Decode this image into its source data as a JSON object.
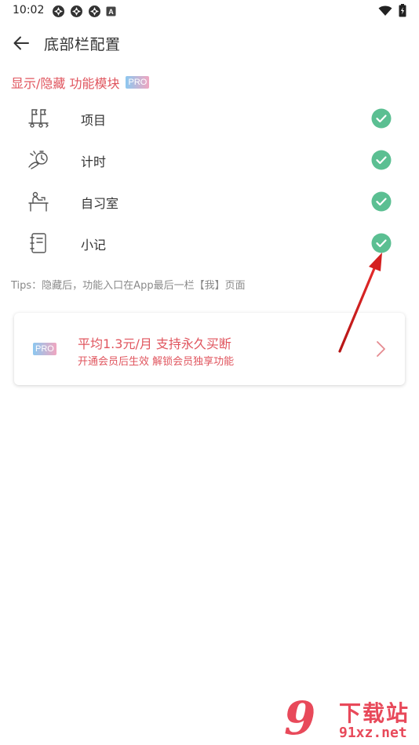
{
  "status_bar": {
    "time": "10:02",
    "left_icons": [
      "notification-icon",
      "notification-icon",
      "notification-icon",
      "keyboard-icon"
    ],
    "right_icons": [
      "wifi-icon",
      "battery-icon"
    ]
  },
  "app_bar": {
    "back_icon": "arrow-left-icon",
    "title": "底部栏配置"
  },
  "section": {
    "title": "显示/隐藏 功能模块",
    "badge": "PRO"
  },
  "modules": [
    {
      "label": "项目",
      "icon": "project-flag-icon",
      "checked": true
    },
    {
      "label": "计时",
      "icon": "timer-hand-icon",
      "checked": true
    },
    {
      "label": "自习室",
      "icon": "study-room-desk-icon",
      "checked": true
    },
    {
      "label": "小记",
      "icon": "notebook-icon",
      "checked": true
    }
  ],
  "tips": "Tips：隐藏后，功能入口在App最后一栏【我】页面",
  "pro_card": {
    "badge": "PRO",
    "title": "平均1.3元/月 支持永久买断",
    "subtitle": "开通会员后生效 解锁会员独享功能",
    "chevron_icon": "chevron-right-icon"
  },
  "colors": {
    "accent": "#e0555e",
    "check_green": "#5bbf92",
    "text": "#333333",
    "muted": "#8a8a8a",
    "annotation_arrow": "#d42020"
  },
  "watermark": {
    "top": "下载站",
    "bottom": "91xz.net"
  }
}
